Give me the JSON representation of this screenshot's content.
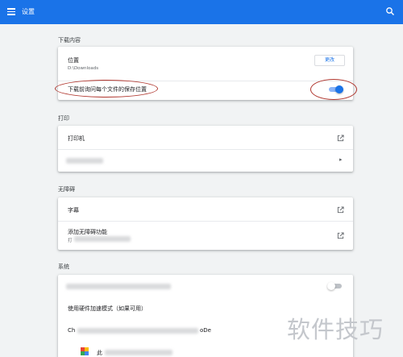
{
  "header": {
    "title": "设置",
    "menu_icon": "menu-icon",
    "search_icon": "search-icon",
    "accent": "#1a73e8"
  },
  "downloads": {
    "section_title": "下载内容",
    "location_label": "位置",
    "location_path": "D:\\Downloads",
    "change_button": "更改",
    "ask_label": "下载前询问每个文件的保存位置",
    "ask_enabled": true
  },
  "printing": {
    "section_title": "打印",
    "printers_label": "打印机"
  },
  "accessibility": {
    "section_title": "无障碍",
    "captions_label": "字幕",
    "add_features_label": "添加无障碍功能",
    "add_features_sub": "打"
  },
  "system": {
    "section_title": "系统",
    "hw_accel_label": "使用硬件加速模式（如果可用）",
    "row_prefix": "Ch",
    "row_suffix": "oDe",
    "app_prefix": "此"
  },
  "watermark": "软件技巧"
}
